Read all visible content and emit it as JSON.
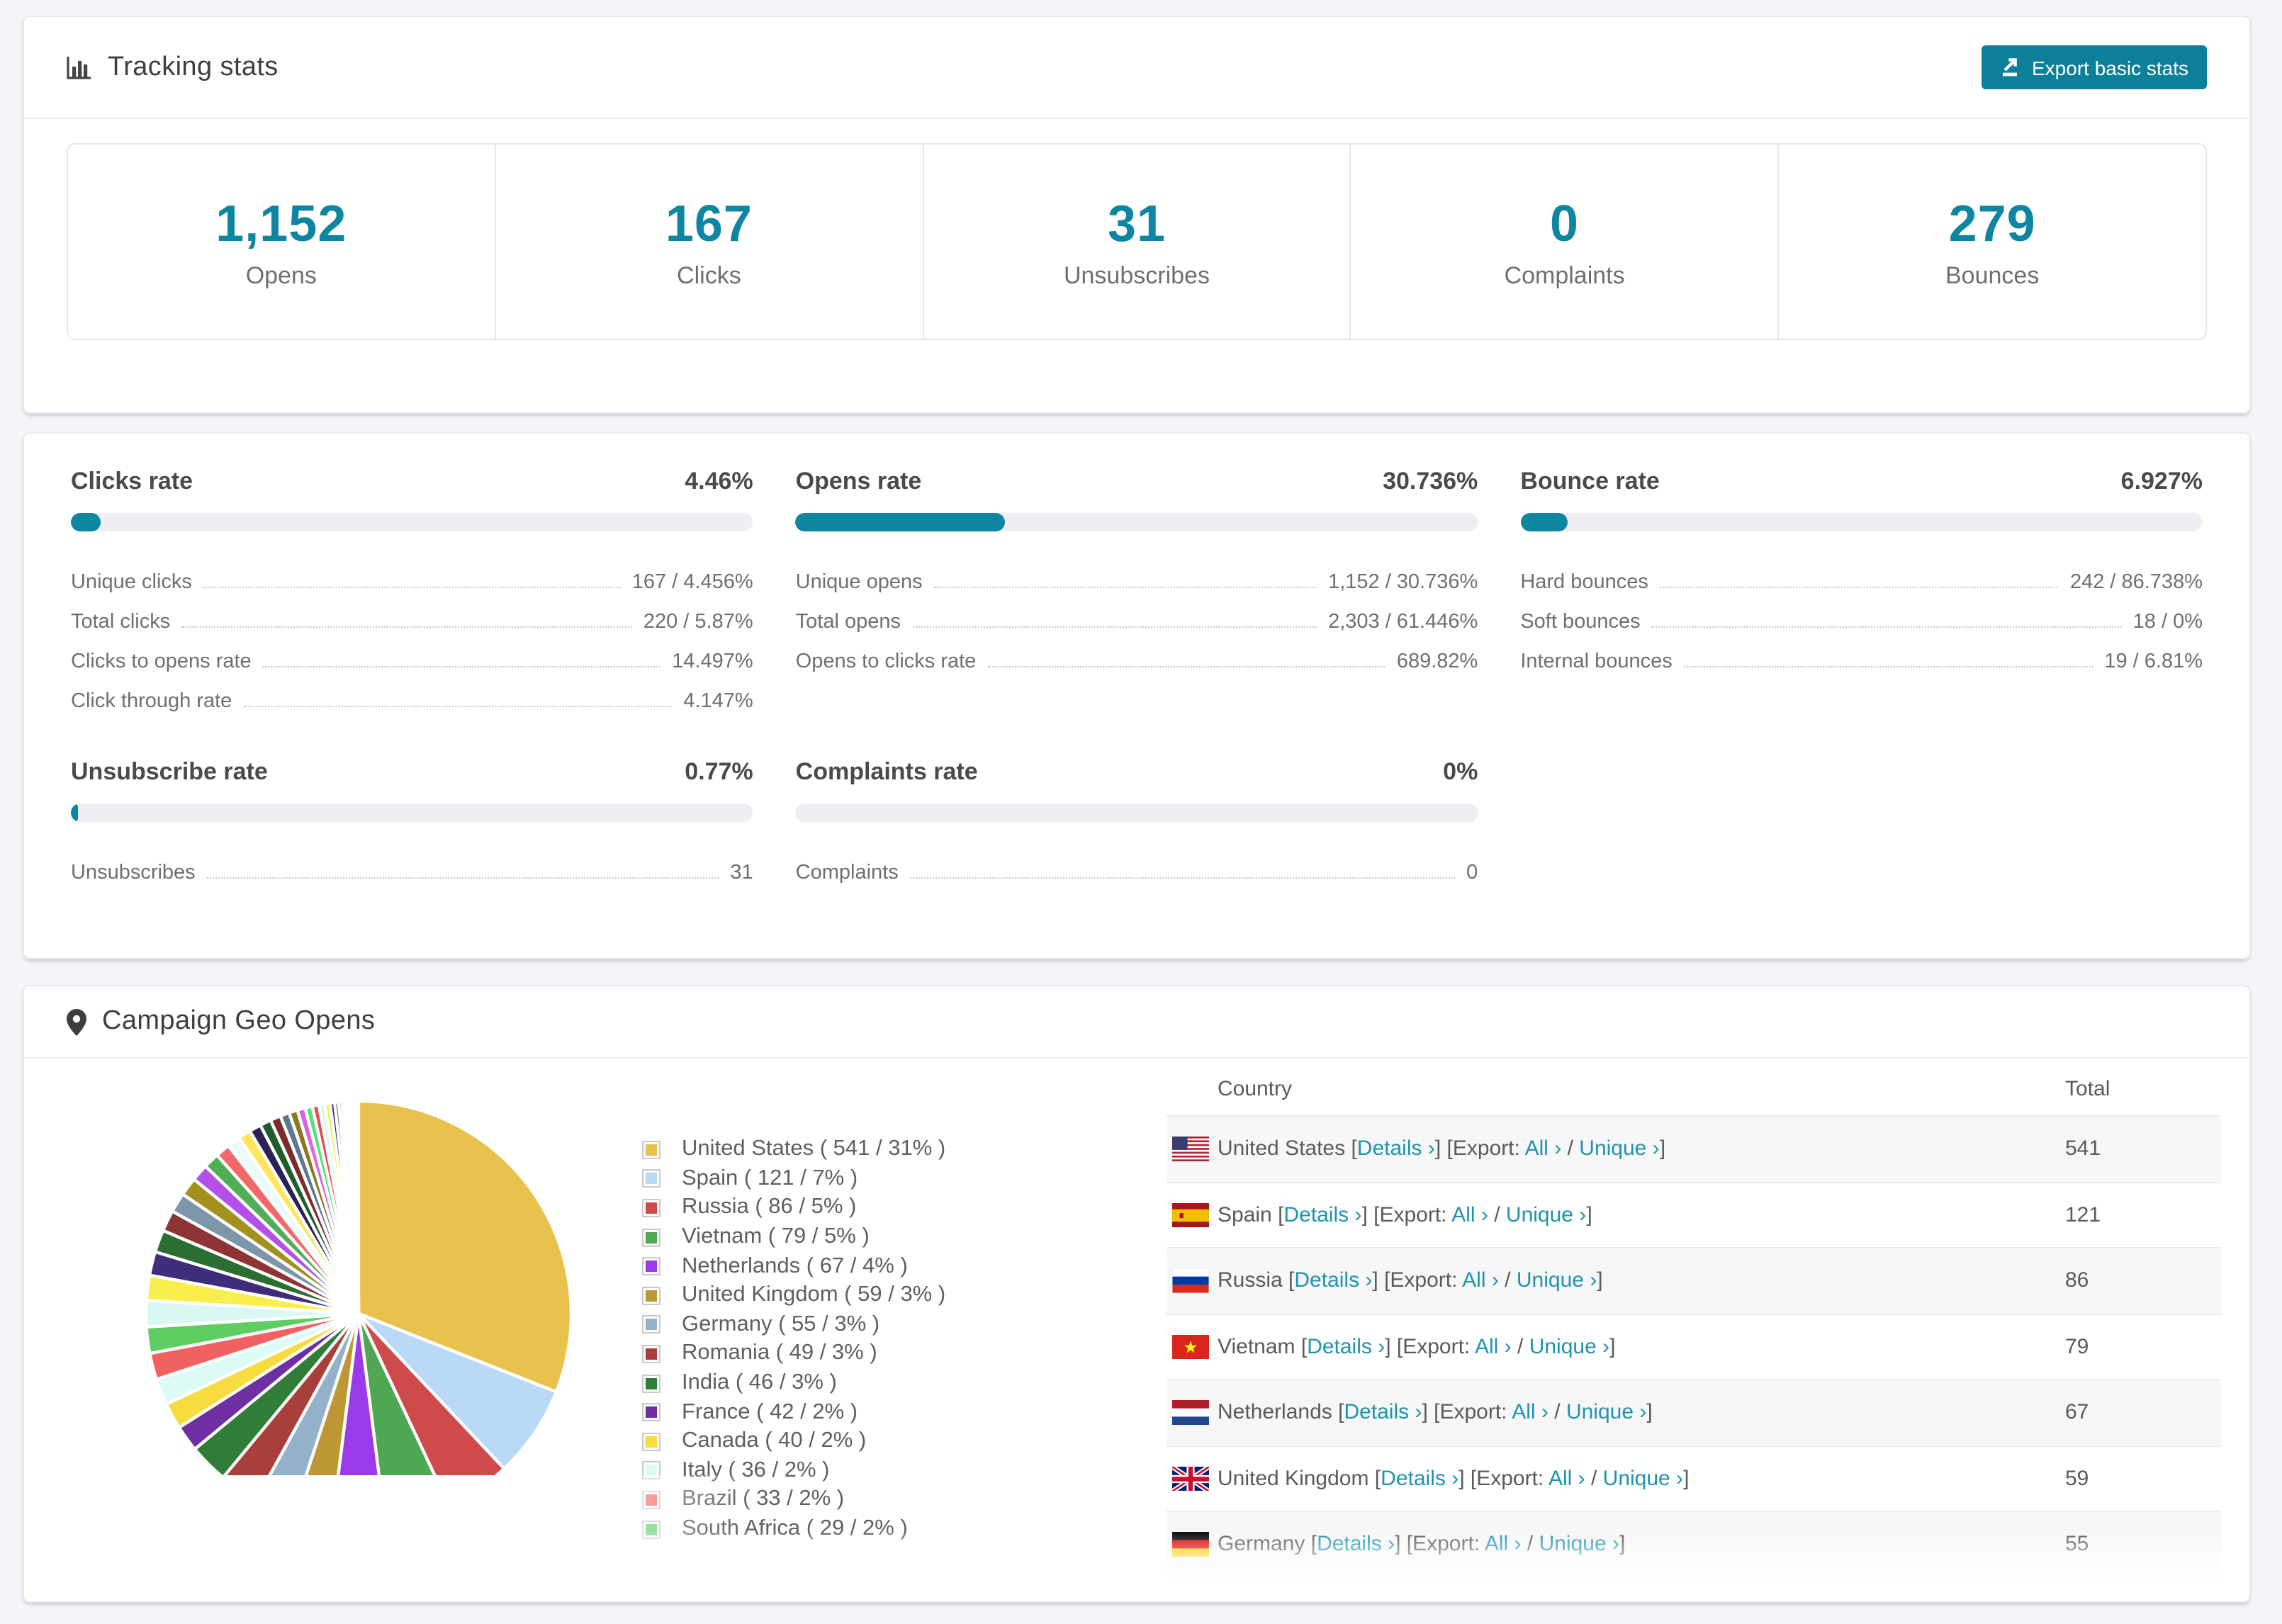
{
  "colors": {
    "accent": "#0e86a2",
    "accent_dark": "#0c7f9b",
    "link": "#1f93ae"
  },
  "header": {
    "title": "Tracking stats",
    "export_button": "Export basic stats"
  },
  "summary_stats": [
    {
      "value": "1,152",
      "label": "Opens"
    },
    {
      "value": "167",
      "label": "Clicks"
    },
    {
      "value": "31",
      "label": "Unsubscribes"
    },
    {
      "value": "0",
      "label": "Complaints"
    },
    {
      "value": "279",
      "label": "Bounces"
    }
  ],
  "rate_panels": [
    {
      "title": "Clicks rate",
      "rate": "4.46%",
      "bar_pct": 4.46,
      "rows": [
        [
          "Unique clicks",
          "167 / 4.456%"
        ],
        [
          "Total clicks",
          "220 / 5.87%"
        ],
        [
          "Clicks to opens rate",
          "14.497%"
        ],
        [
          "Click through rate",
          "4.147%"
        ]
      ]
    },
    {
      "title": "Opens rate",
      "rate": "30.736%",
      "bar_pct": 30.736,
      "rows": [
        [
          "Unique opens",
          "1,152 / 30.736%"
        ],
        [
          "Total opens",
          "2,303 / 61.446%"
        ],
        [
          "Opens to clicks rate",
          "689.82%"
        ]
      ]
    },
    {
      "title": "Bounce rate",
      "rate": "6.927%",
      "bar_pct": 6.927,
      "rows": [
        [
          "Hard bounces",
          "242 / 86.738%"
        ],
        [
          "Soft bounces",
          "18 / 0%"
        ],
        [
          "Internal bounces",
          "19 / 6.81%"
        ]
      ]
    },
    {
      "title": "Unsubscribe rate",
      "rate": "0.77%",
      "bar_pct": 0.77,
      "rows": [
        [
          "Unsubscribes",
          "31"
        ]
      ]
    },
    {
      "title": "Complaints rate",
      "rate": "0%",
      "bar_pct": 0,
      "rows": [
        [
          "Complaints",
          "0"
        ]
      ]
    }
  ],
  "geo": {
    "title": "Campaign Geo Opens",
    "table": {
      "columns": [
        "Country",
        "Total"
      ],
      "link_labels": {
        "details": "Details ›",
        "export": "Export:",
        "all": "All ›",
        "unique": "Unique ›"
      },
      "rows": [
        {
          "country": "United States",
          "flag": "us",
          "total": "541"
        },
        {
          "country": "Spain",
          "flag": "es",
          "total": "121"
        },
        {
          "country": "Russia",
          "flag": "ru",
          "total": "86"
        },
        {
          "country": "Vietnam",
          "flag": "vn",
          "total": "79"
        },
        {
          "country": "Netherlands",
          "flag": "nl",
          "total": "67"
        },
        {
          "country": "United Kingdom",
          "flag": "gb",
          "total": "59"
        },
        {
          "country": "Germany",
          "flag": "de",
          "total": "55"
        }
      ]
    }
  },
  "chart_data": {
    "type": "pie",
    "title": "Campaign Geo Opens",
    "unit": "opens",
    "start_angle_deg": 0,
    "direction": "clockwise",
    "legend_position": "right",
    "slices": [
      {
        "label": "United States",
        "value": 541,
        "pct": 31,
        "color": "#e9c24d"
      },
      {
        "label": "Spain",
        "value": 121,
        "pct": 7,
        "color": "#b9d9f6"
      },
      {
        "label": "Russia",
        "value": 86,
        "pct": 5,
        "color": "#cf4b4b"
      },
      {
        "label": "Vietnam",
        "value": 79,
        "pct": 5,
        "color": "#4fa653"
      },
      {
        "label": "Netherlands",
        "value": 67,
        "pct": 4,
        "color": "#9b3ae8"
      },
      {
        "label": "United Kingdom",
        "value": 59,
        "pct": 3,
        "color": "#bd9733"
      },
      {
        "label": "Germany",
        "value": 55,
        "pct": 3,
        "color": "#93b1c9"
      },
      {
        "label": "Romania",
        "value": 49,
        "pct": 3,
        "color": "#a83f3b"
      },
      {
        "label": "India",
        "value": 46,
        "pct": 3,
        "color": "#2f7d36"
      },
      {
        "label": "France",
        "value": 42,
        "pct": 2,
        "color": "#6e2fa3"
      },
      {
        "label": "Canada",
        "value": 40,
        "pct": 2,
        "color": "#f7dc40"
      },
      {
        "label": "Italy",
        "value": 36,
        "pct": 2,
        "color": "#dcfbf6"
      },
      {
        "label": "Brazil",
        "value": 33,
        "pct": 2,
        "color": "#f26161"
      },
      {
        "label": "South Africa",
        "value": 29,
        "pct": 2,
        "color": "#5fce62"
      }
    ],
    "other_slices_pcts": [
      2.0,
      1.9,
      1.8,
      1.7,
      1.6,
      1.5,
      1.4,
      1.3,
      1.2,
      1.1,
      1.0,
      0.95,
      0.9,
      0.85,
      0.8,
      0.7,
      0.65,
      0.6,
      0.55,
      0.5,
      0.45,
      0.4,
      0.35,
      0.3,
      0.25,
      0.2,
      0.17,
      0.14,
      0.12,
      0.1,
      0.08,
      0.07,
      0.06,
      0.05,
      0.04,
      0.03,
      0.03,
      0.02,
      0.02
    ],
    "other_slices_palette": [
      "#d9f7f3",
      "#f8ef4e",
      "#3f2d7c",
      "#2a6e31",
      "#8e3434",
      "#7e96a9",
      "#a3901f",
      "#b44fe8",
      "#4fae57",
      "#f26868",
      "#eafbfa",
      "#ffe45c",
      "#2b2157",
      "#1f5d2a",
      "#7a2b2b",
      "#5c7890",
      "#8c7820",
      "#e060e0",
      "#55e07a",
      "#e84b4b"
    ]
  }
}
